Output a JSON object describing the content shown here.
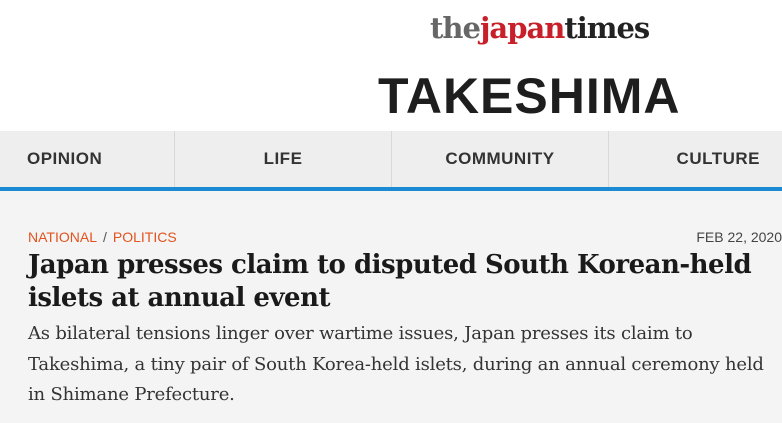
{
  "header": {
    "logo": {
      "the": "the",
      "japan": "japan",
      "times": "times"
    },
    "topic_title": "TAKESHIMA"
  },
  "nav": {
    "items": [
      {
        "label": "OPINION"
      },
      {
        "label": "LIFE"
      },
      {
        "label": "COMMUNITY"
      },
      {
        "label": "CULTURE"
      }
    ]
  },
  "article": {
    "categories": [
      "NATIONAL",
      "POLITICS"
    ],
    "separator": "/",
    "date": "FEB 22, 2020",
    "headline": "Japan presses claim to disputed South Korean-held islets at annual event",
    "summary": "As bilateral tensions linger over wartime issues, Japan presses its claim to Takeshima, a tiny pair of South Korea-held islets, during an annual ceremony held in Shimane Prefecture."
  },
  "colors": {
    "accent": "#1b8ad3",
    "category": "#e2531e",
    "logo_red": "#c8202a"
  }
}
